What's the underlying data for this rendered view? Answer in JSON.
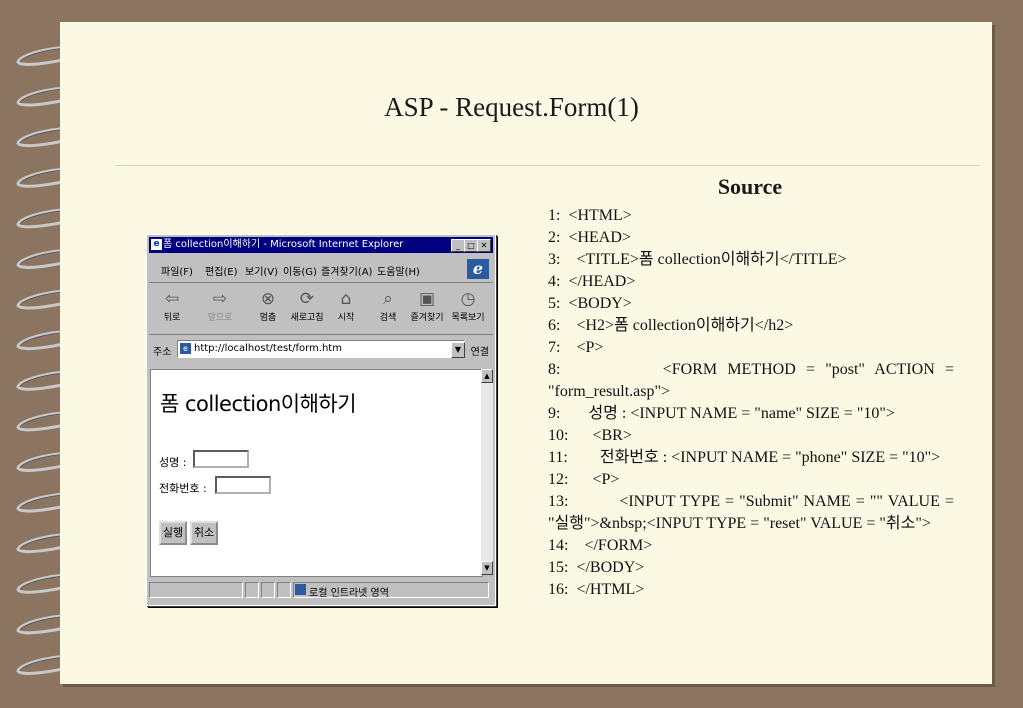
{
  "slide": {
    "title": "ASP - Request.Form(1)",
    "source_heading": "Source",
    "code_lines": [
      "1:  <HTML>",
      "2:  <HEAD>",
      "3:    <TITLE>폼 collection이해하기</TITLE>",
      "4:  </HEAD>",
      "5:  <BODY>",
      "6:    <H2>폼 collection이해하기</h2>",
      "7:    <P>",
      "8:          <FORM METHOD = \"post\" ACTION = \"form_result.asp\">",
      "9:       성명 : <INPUT NAME = \"name\" SIZE = \"10\">",
      "10:      <BR>",
      "11:        전화번호 : <INPUT NAME = \"phone\" SIZE = \"10\">",
      "12:      <P>",
      "13:          <INPUT TYPE = \"Submit\" NAME = \"\" VALUE = \"실행\">&nbsp;<INPUT TYPE = \"reset\" VALUE = \"취소\">",
      "14:    </FORM>",
      "15:  </BODY>",
      "16:  </HTML>"
    ]
  },
  "browser": {
    "window_title": "폼 collection이해하기 - Microsoft Internet Explorer",
    "menu": [
      "파일(F)",
      "편집(E)",
      "보기(V)",
      "이동(G)",
      "즐겨찾기(A)",
      "도움말(H)"
    ],
    "toolbar": {
      "back": "뒤로",
      "forward": "앞으로",
      "stop": "멈춤",
      "refresh": "새로고침",
      "home": "시작",
      "search": "검색",
      "favorites": "즐겨찾기",
      "history": "목록보기"
    },
    "address_label": "주소",
    "address_value": "http://localhost/test/form.htm",
    "go_label": "연결",
    "page": {
      "heading": "폼 collection이해하기",
      "name_label": "성명 :",
      "phone_label": "전화번호 :",
      "submit_label": "실행",
      "reset_label": "취소"
    },
    "status_zone": "로컬 인트라넷 영역"
  }
}
